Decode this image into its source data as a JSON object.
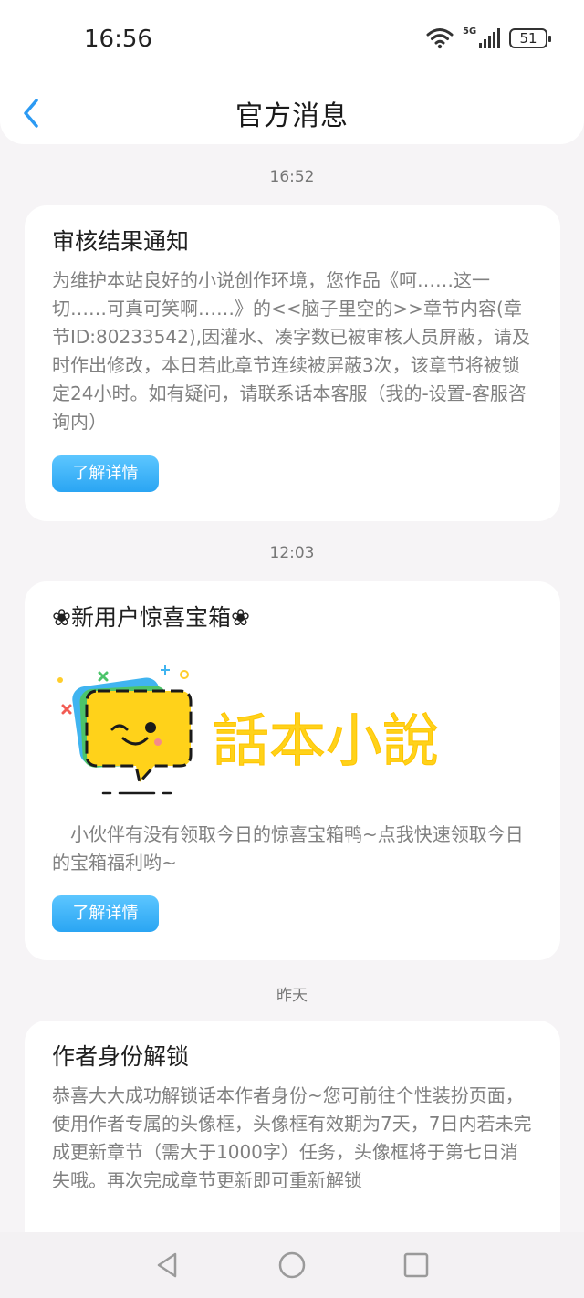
{
  "status": {
    "time": "16:56",
    "battery": "51",
    "network": "5G"
  },
  "header": {
    "title": "官方消息"
  },
  "messages": [
    {
      "time": "16:52",
      "title": "审核结果通知",
      "body": "为维护本站良好的小说创作环境，您作品《呵……这一切……可真可笑啊……》的<<脑子里空的>>章节内容(章节ID:80233542),因灌水、凑字数已被审核人员屏蔽，请及时作出修改，本日若此章节连续被屏蔽3次，该章节将被锁定24小时。如有疑问，请联系话本客服（我的-设置-客服咨询内）",
      "button": "了解详情"
    },
    {
      "time": "12:03",
      "title": "❀新用户惊喜宝箱❀",
      "banner_text": "話本小說",
      "body": "　小伙伴有没有领取今日的惊喜宝箱鸭~点我快速领取今日的宝箱福利哟~",
      "button": "了解详情"
    },
    {
      "time": "昨天",
      "title": "作者身份解锁",
      "body": "恭喜大大成功解锁话本作者身份~您可前往个性装扮页面，使用作者专属的头像框，头像框有效期为7天，7日内若未完成更新章节（需大于1000字）任务，头像框将于第七日消失哦。再次完成章节更新即可重新解锁"
    }
  ],
  "colors": {
    "accent": "#2aa5f3",
    "back_arrow": "#2b9af3",
    "banner_yellow": "#ffd21a"
  },
  "nav": {
    "back": "triangle-back-icon",
    "home": "circle-home-icon",
    "recent": "square-recent-icon"
  }
}
